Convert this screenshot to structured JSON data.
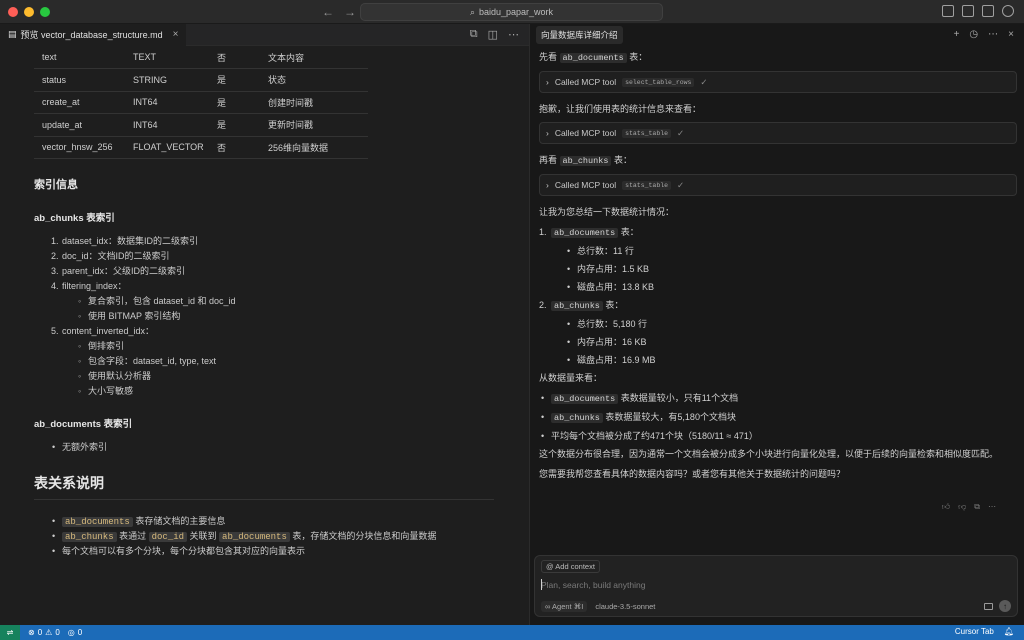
{
  "window": {
    "search_text": "baidu_papar_work",
    "nav_back": "←",
    "nav_forward": "→"
  },
  "editor": {
    "tab_label": "预览 vector_database_structure.md",
    "tab_close": "×",
    "table_rows": [
      {
        "name": "text",
        "type": "TEXT",
        "nullable": "否",
        "desc": "文本内容"
      },
      {
        "name": "status",
        "type": "STRING",
        "nullable": "是",
        "desc": "状态"
      },
      {
        "name": "create_at",
        "type": "INT64",
        "nullable": "是",
        "desc": "创建时间戳"
      },
      {
        "name": "update_at",
        "type": "INT64",
        "nullable": "是",
        "desc": "更新时间戳"
      },
      {
        "name": "vector_hnsw_256",
        "type": "FLOAT_VECTOR",
        "nullable": "否",
        "desc": "256维向量数据"
      }
    ],
    "index_heading": "索引信息",
    "chunks_index_heading": "ab_chunks 表索引",
    "chunks_indexes": [
      {
        "num": "1.",
        "text": "dataset_idx：数据集ID的二级索引"
      },
      {
        "num": "2.",
        "text": "doc_id：文档ID的二级索引"
      },
      {
        "num": "3.",
        "text": "parent_idx：父级ID的二级索引"
      },
      {
        "num": "4.",
        "text": "filtering_index："
      },
      {
        "num": "5.",
        "text": "content_inverted_idx："
      }
    ],
    "filtering_sub": [
      "复合索引，包含 dataset_id 和 doc_id",
      "使用 BITMAP 索引结构"
    ],
    "content_sub": [
      "倒排索引",
      "包含字段：dataset_id, type, text",
      "使用默认分析器",
      "大小写敏感"
    ],
    "documents_index_heading": "ab_documents 表索引",
    "documents_indexes": [
      "无额外索引"
    ],
    "relation_heading": "表关系说明",
    "relations": {
      "r1_code": "ab_documents",
      "r1_text": " 表存储文档的主要信息",
      "r2_code1": "ab_chunks",
      "r2_mid1": " 表通过 ",
      "r2_code2": "doc_id",
      "r2_mid2": " 关联到 ",
      "r2_code3": "ab_documents",
      "r2_text": " 表，存储文档的分块信息和向量数据",
      "r3_text": "每个文档可以有多个分块，每个分块都包含其对应的向量表示"
    }
  },
  "chat": {
    "tab_label": "向量数据库详细介绍",
    "msg1_pre": "先看 ",
    "msg1_code": "ab_documents",
    "msg1_post": " 表：",
    "mcp_label": "Called MCP tool",
    "mcp1_tag": "select_table_rows",
    "msg2": "抱歉，让我们使用表的统计信息来查看：",
    "mcp2_tag": "stats_table",
    "msg3_pre": "再看 ",
    "msg3_code": "ab_chunks",
    "msg3_post": " 表：",
    "mcp3_tag": "stats_table",
    "summary_intro": "让我为您总结一下数据统计情况：",
    "stat1_num": "1.",
    "stat1_code": "ab_documents",
    "stat1_post": " 表：",
    "stat1_items": [
      "总行数：11 行",
      "内存占用：1.5 KB",
      "磁盘占用：13.8 KB"
    ],
    "stat2_num": "2.",
    "stat2_code": "ab_chunks",
    "stat2_post": " 表：",
    "stat2_items": [
      "总行数：5,180 行",
      "内存占用：16 KB",
      "磁盘占用：16.9 MB"
    ],
    "view_intro": "从数据量来看：",
    "view1_code": "ab_documents",
    "view1_text": " 表数据量较小，只有11个文档",
    "view2_code": "ab_chunks",
    "view2_text": " 表数据量较大，有5,180个文档块",
    "view3_text": "平均每个文档被分成了约471个块（5180/11 ≈ 471）",
    "conclusion": "这个数据分布很合理，因为通常一个文档会被分成多个小块进行向量化处理，以便于后续的向量检索和相似度匹配。",
    "question": "您需要我帮您查看具体的数据内容吗？或者您有其他关于数据统计的问题吗？",
    "composer": {
      "add_context": "Add context",
      "placeholder": "Plan, search, build anything",
      "agent_label": "Agent",
      "agent_shortcut": "⌘I",
      "model": "claude-3.5-sonnet"
    }
  },
  "statusbar": {
    "errors": "0",
    "warnings": "0",
    "ports": "0",
    "right_label": "Cursor Tab"
  }
}
